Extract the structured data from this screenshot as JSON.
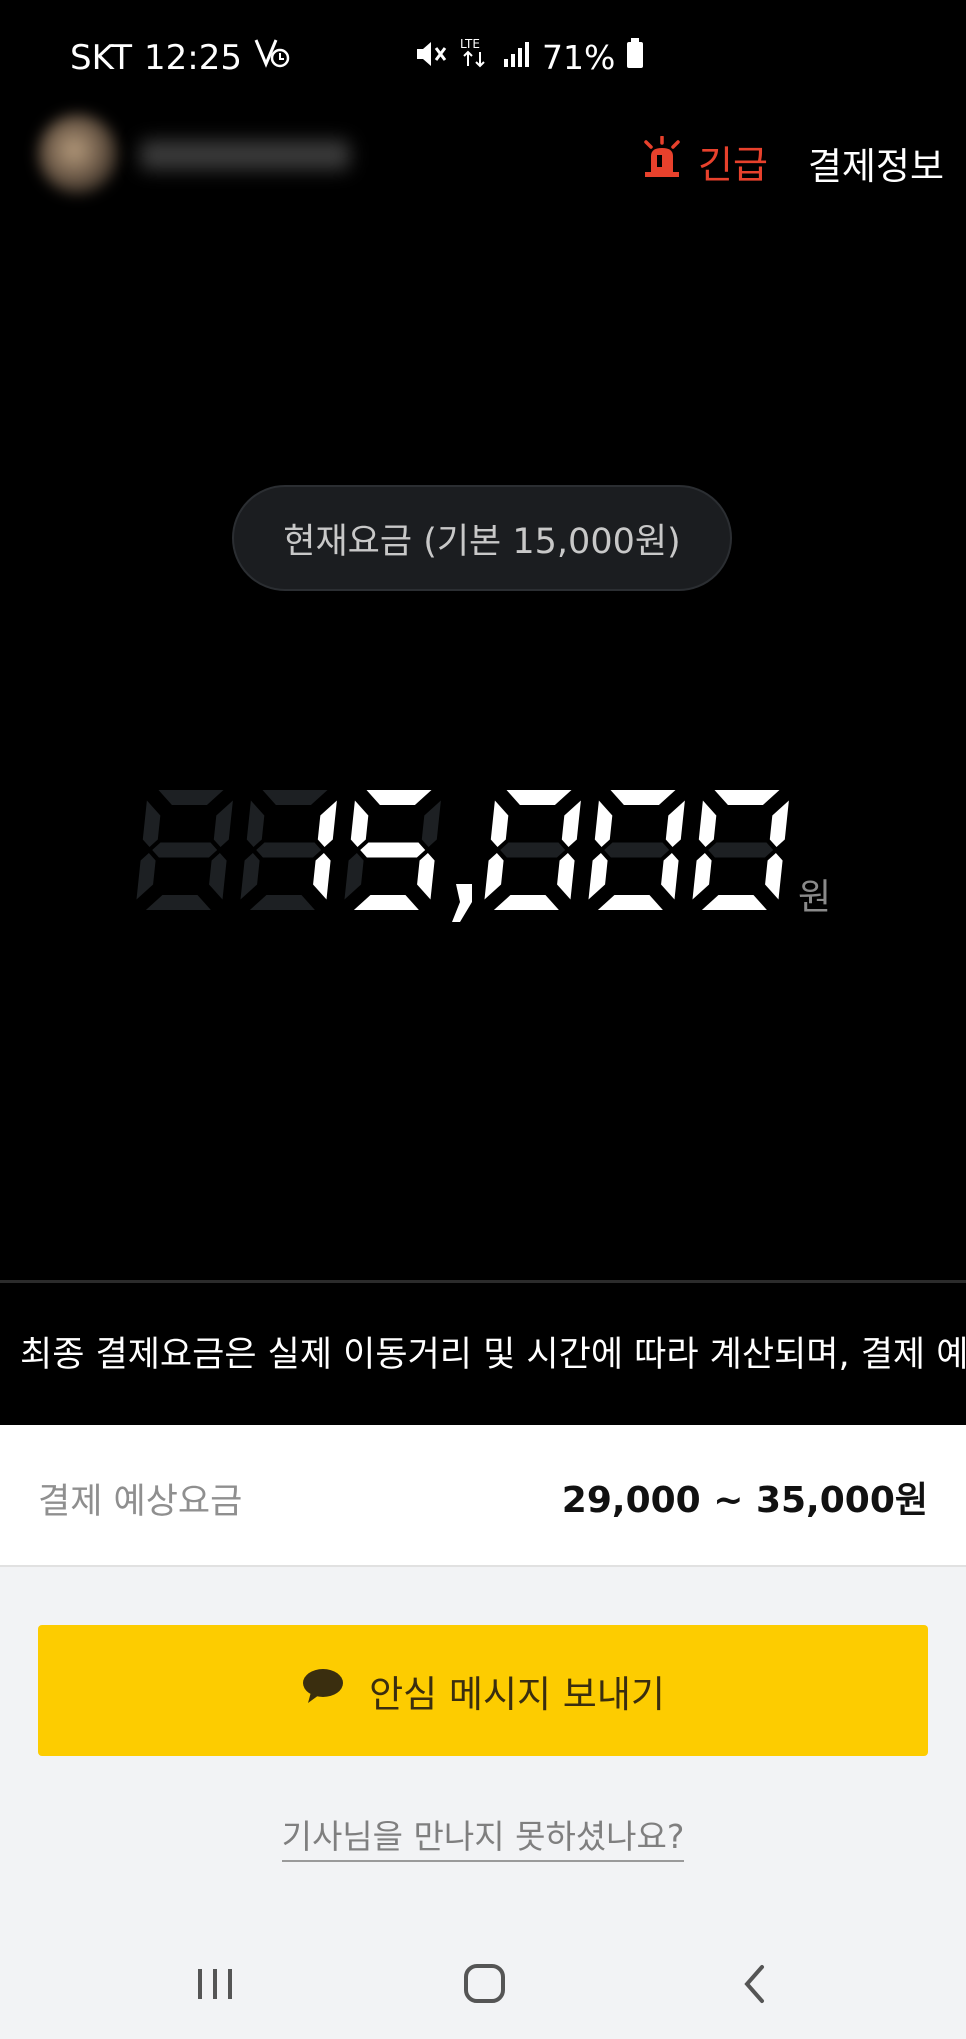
{
  "status_bar": {
    "carrier": "SKT",
    "time": "12:25",
    "network": "LTE",
    "battery": "71%"
  },
  "header": {
    "emergency_label": "긴급",
    "payment_info_label": "결제정보"
  },
  "fare": {
    "base_fare_label": "현재요금 (기본 15,000원)",
    "current_fare": "15,000",
    "unit": "원",
    "color_lit": "#ffffff",
    "color_unlit": "#1d2023"
  },
  "notice": {
    "ticker_text": "최종 결제요금은 실제 이동거리 및 시간에 따라 계산되며, 결제 예"
  },
  "estimate": {
    "label": "결제 예상요금",
    "value": "29,000 ~ 35,000원"
  },
  "actions": {
    "safe_message_label": "안심 메시지 보내기",
    "didnt_meet_label": "기사님을 만나지 못하셨나요?"
  },
  "colors": {
    "emergency": "#e8412c",
    "cta_background": "#fdcc00"
  },
  "navbar": {
    "icons": [
      "recent-apps-icon",
      "home-icon",
      "back-icon"
    ]
  }
}
